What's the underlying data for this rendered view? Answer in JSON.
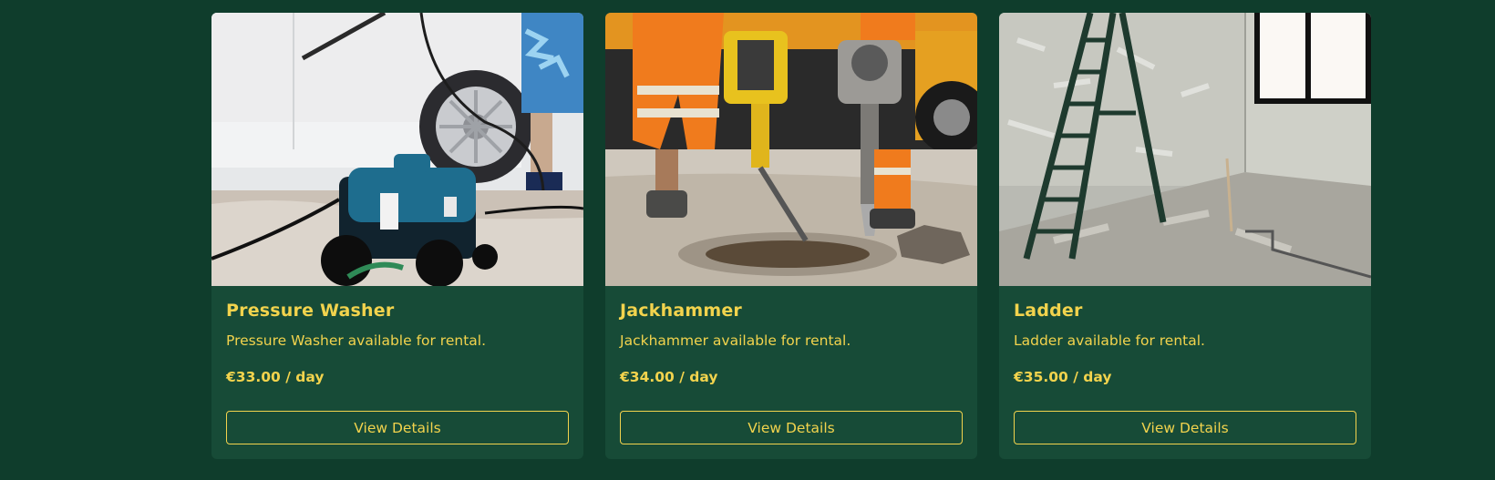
{
  "products": [
    {
      "title": "Pressure Washer",
      "description": "Pressure Washer available for rental.",
      "price": "€33.00 / day",
      "button_label": "View Details",
      "image_subject": "pressure-washer"
    },
    {
      "title": "Jackhammer",
      "description": "Jackhammer available for rental.",
      "price": "€34.00 / day",
      "button_label": "View Details",
      "image_subject": "jackhammer"
    },
    {
      "title": "Ladder",
      "description": "Ladder available for rental.",
      "price": "€35.00 / day",
      "button_label": "View Details",
      "image_subject": "ladder"
    }
  ],
  "colors": {
    "page_background": "#0f3d2c",
    "card_background": "#174b37",
    "accent": "#f2d34d"
  }
}
